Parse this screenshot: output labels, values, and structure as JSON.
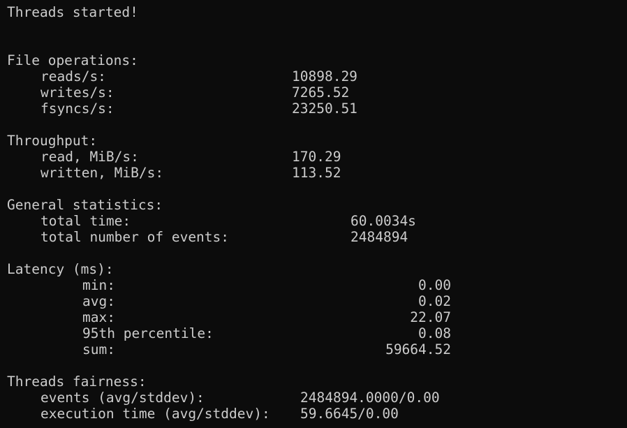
{
  "banner": "Threads started!",
  "file_operations": {
    "heading": "File operations:",
    "rows": [
      {
        "label": "reads/s:",
        "value": "10898.29"
      },
      {
        "label": "writes/s:",
        "value": "7265.52"
      },
      {
        "label": "fsyncs/s:",
        "value": "23250.51"
      }
    ]
  },
  "throughput": {
    "heading": "Throughput:",
    "rows": [
      {
        "label": "read, MiB/s:",
        "value": "170.29"
      },
      {
        "label": "written, MiB/s:",
        "value": "113.52"
      }
    ]
  },
  "general_statistics": {
    "heading": "General statistics:",
    "rows": [
      {
        "label": "total time:",
        "value": "60.0034s"
      },
      {
        "label": "total number of events:",
        "value": "2484894"
      }
    ]
  },
  "latency": {
    "heading": "Latency (ms):",
    "rows": [
      {
        "label": "min:",
        "value": "0.00"
      },
      {
        "label": "avg:",
        "value": "0.02"
      },
      {
        "label": "max:",
        "value": "22.07"
      },
      {
        "label": "95th percentile:",
        "value": "0.08"
      },
      {
        "label": "sum:",
        "value": "59664.52"
      }
    ]
  },
  "threads_fairness": {
    "heading": "Threads fairness:",
    "rows": [
      {
        "label": "events (avg/stddev):",
        "value": "2484894.0000/0.00"
      },
      {
        "label": "execution time (avg/stddev):",
        "value": "59.6645/0.00"
      }
    ]
  }
}
